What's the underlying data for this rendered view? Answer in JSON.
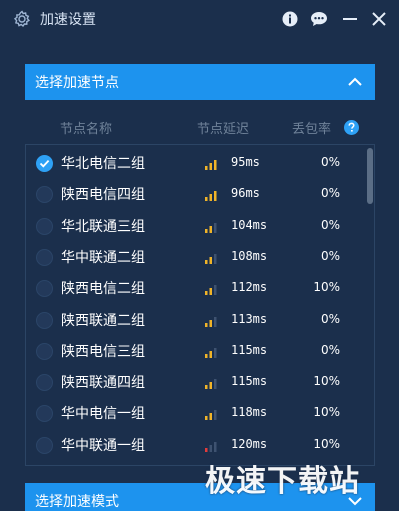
{
  "window": {
    "title": "加速设置"
  },
  "titlebar_icons": [
    "gear-icon",
    "info-icon",
    "chat-icon",
    "minimize-icon",
    "close-icon"
  ],
  "node_section": {
    "header": "选择加速节点",
    "expanded": true,
    "columns": {
      "name": "节点名称",
      "latency": "节点延迟",
      "loss": "丢包率"
    },
    "nodes": [
      {
        "name": "华北电信二组",
        "latency": "95ms",
        "loss": "0%",
        "signal_bars": 3,
        "selected": true
      },
      {
        "name": "陕西电信四组",
        "latency": "96ms",
        "loss": "0%",
        "signal_bars": 3,
        "selected": false
      },
      {
        "name": "华北联通三组",
        "latency": "104ms",
        "loss": "0%",
        "signal_bars": 2,
        "selected": false
      },
      {
        "name": "华中联通二组",
        "latency": "108ms",
        "loss": "0%",
        "signal_bars": 2,
        "selected": false
      },
      {
        "name": "陕西电信二组",
        "latency": "112ms",
        "loss": "10%",
        "signal_bars": 2,
        "selected": false
      },
      {
        "name": "陕西联通二组",
        "latency": "113ms",
        "loss": "0%",
        "signal_bars": 2,
        "selected": false
      },
      {
        "name": "陕西电信三组",
        "latency": "115ms",
        "loss": "0%",
        "signal_bars": 2,
        "selected": false
      },
      {
        "name": "陕西联通四组",
        "latency": "115ms",
        "loss": "10%",
        "signal_bars": 2,
        "selected": false
      },
      {
        "name": "华中电信一组",
        "latency": "118ms",
        "loss": "10%",
        "signal_bars": 2,
        "selected": false
      },
      {
        "name": "华中联通一组",
        "latency": "120ms",
        "loss": "10%",
        "signal_bars": 1,
        "selected": false
      }
    ],
    "scroll_position": 0.0
  },
  "mode_section": {
    "header": "选择加速模式",
    "expanded": false
  },
  "watermark": "极速下载站",
  "colors": {
    "background": "#1b2f4c",
    "accent": "#1d93ee",
    "signal_good": "#f0b429",
    "signal_bad": "#e23b3b",
    "signal_empty": "#3e5270",
    "muted_text": "#6f8299"
  }
}
